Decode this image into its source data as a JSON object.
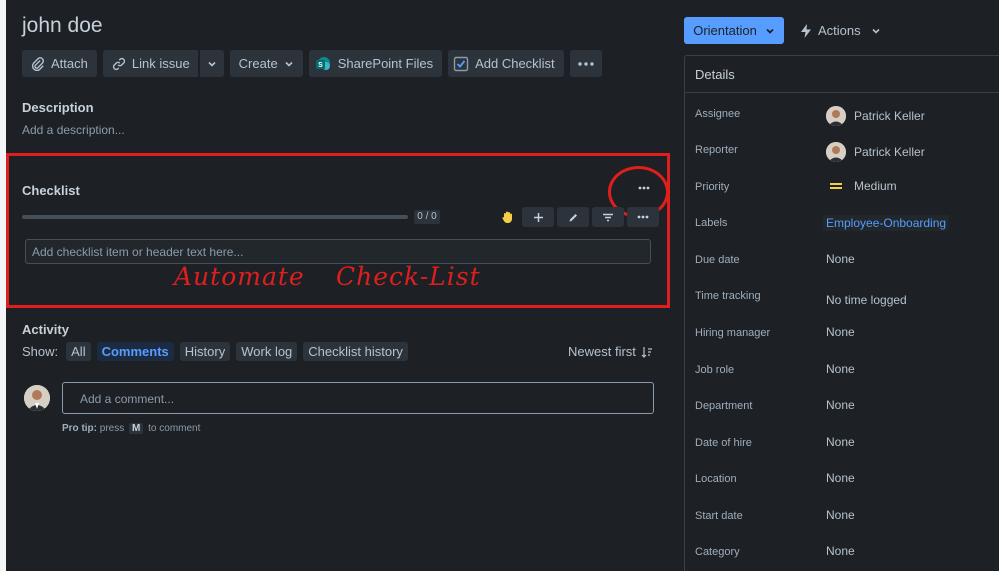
{
  "issue": {
    "title": "john doe"
  },
  "toolbar": {
    "attach": "Attach",
    "link_issue": "Link issue",
    "create": "Create",
    "sharepoint": "SharePoint Files",
    "add_checklist": "Add Checklist"
  },
  "description": {
    "label": "Description",
    "placeholder": "Add a description..."
  },
  "checklist": {
    "label": "Checklist",
    "progress": 0,
    "count": "0 / 0",
    "input_placeholder": "Add checklist item or header text here..."
  },
  "annotation": {
    "word1": "Automate",
    "word2": "Check-List"
  },
  "activity": {
    "label": "Activity",
    "show_label": "Show:",
    "filters": [
      "All",
      "Comments",
      "History",
      "Work log",
      "Checklist history"
    ],
    "active_filter": "Comments",
    "sort": "Newest first",
    "comment_placeholder": "Add a comment...",
    "protip_label": "Pro tip:",
    "protip_press": "press",
    "protip_key": "M",
    "protip_rest": "to comment"
  },
  "sidebar": {
    "orientation_button": "Orientation",
    "actions_button": "Actions",
    "details_title": "Details",
    "fields": [
      {
        "label": "Assignee",
        "value": "Patrick Keller",
        "avatar": true
      },
      {
        "label": "Reporter",
        "value": "Patrick Keller",
        "avatar": true
      },
      {
        "label": "Priority",
        "value": "Medium",
        "priority": true
      },
      {
        "label": "Labels",
        "value": "Employee-Onboarding",
        "chip": true
      },
      {
        "label": "Due date",
        "value": "None"
      },
      {
        "label": "Time tracking",
        "value": "No time logged"
      },
      {
        "label": "Hiring manager",
        "value": "None"
      },
      {
        "label": "Job role",
        "value": "None"
      },
      {
        "label": "Department",
        "value": "None"
      },
      {
        "label": "Date of hire",
        "value": "None"
      },
      {
        "label": "Location",
        "value": "None"
      },
      {
        "label": "Start date",
        "value": "None"
      },
      {
        "label": "Category",
        "value": "None"
      }
    ]
  },
  "colors": {
    "accent": "#579dff",
    "annotation_red": "#e01e1e",
    "priority": "#f5cd47"
  }
}
